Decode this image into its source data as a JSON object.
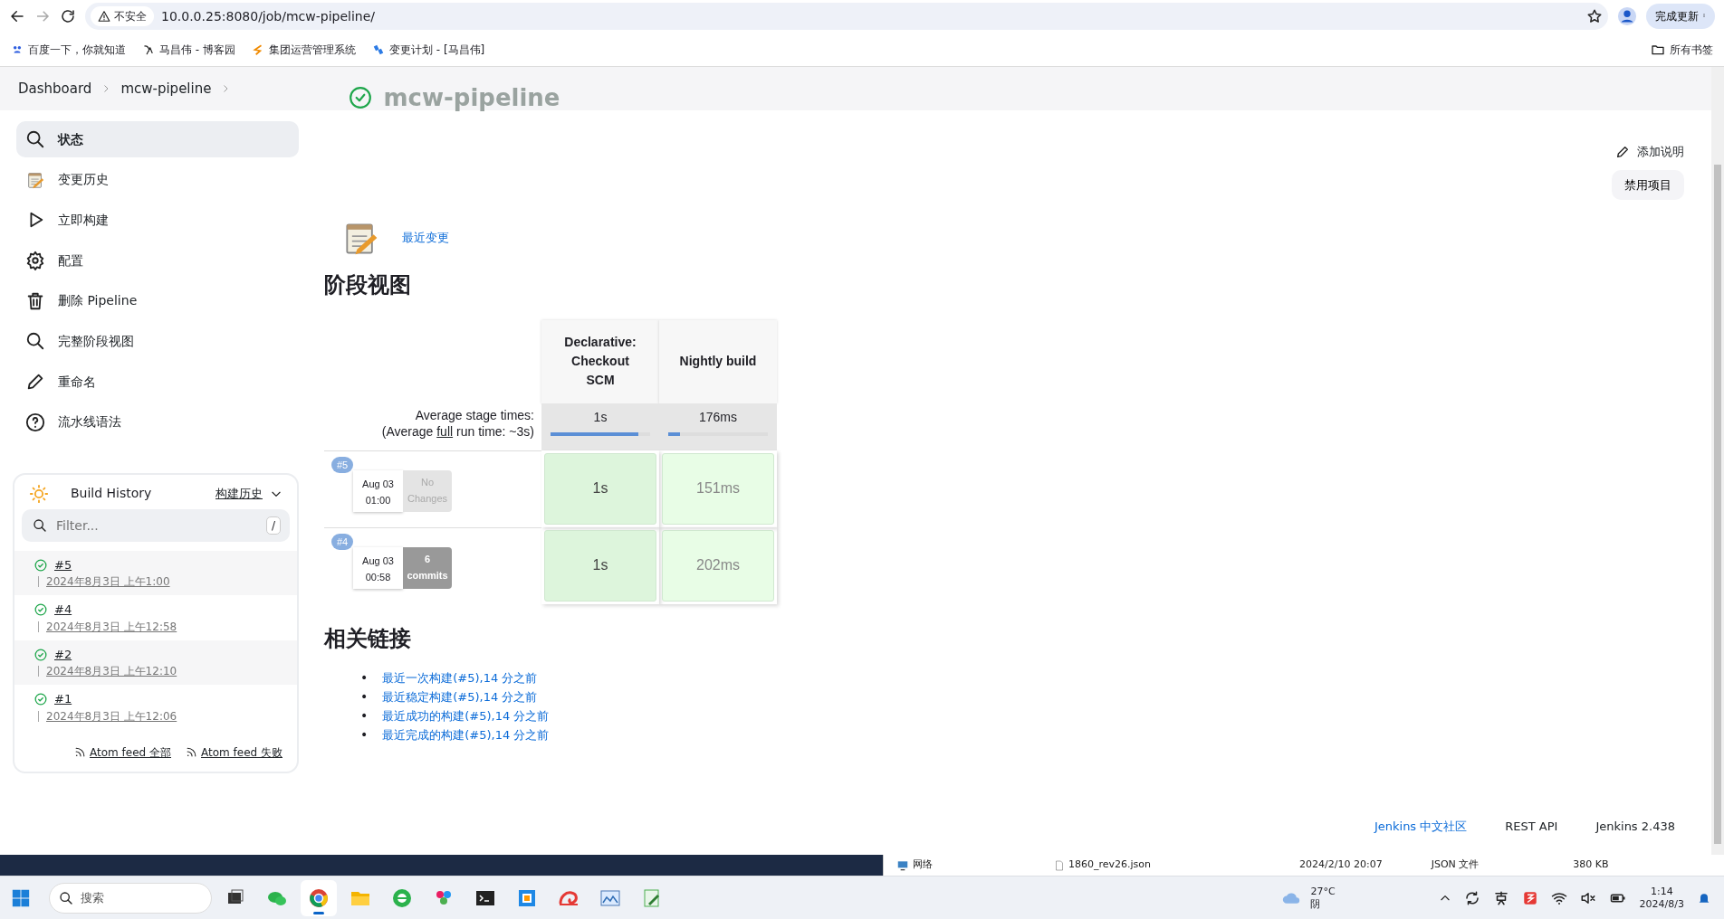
{
  "browser": {
    "security": "不安全",
    "url": "10.0.0.25:8080/job/mcw-pipeline/",
    "update_button": "完成更新",
    "bookmarks": [
      {
        "label": "百度一下，你就知道"
      },
      {
        "label": "马昌伟 - 博客园"
      },
      {
        "label": "集团运营管理系统"
      },
      {
        "label": "变更计划 - [马昌伟]"
      }
    ],
    "all_bookmarks": "所有书签"
  },
  "breadcrumb": [
    {
      "label": "Dashboard"
    },
    {
      "label": "mcw-pipeline"
    }
  ],
  "page_title": "mcw-pipeline",
  "sidebar": {
    "items": [
      {
        "label": "状态",
        "selected": true
      },
      {
        "label": "变更历史",
        "selected": false
      },
      {
        "label": "立即构建",
        "selected": false
      },
      {
        "label": "配置",
        "selected": false
      },
      {
        "label": "删除 Pipeline",
        "selected": false
      },
      {
        "label": "完整阶段视图",
        "selected": false
      },
      {
        "label": "重命名",
        "selected": false
      },
      {
        "label": "流水线语法",
        "selected": false
      }
    ]
  },
  "build_history": {
    "title": "Build History",
    "trend_link": "构建历史",
    "filter_placeholder": "Filter...",
    "filter_shortcut": "/",
    "builds": [
      {
        "number": "#5",
        "time": "2024年8月3日 上午1:00",
        "kind": "success"
      },
      {
        "number": "#4",
        "time": "2024年8月3日 上午12:58",
        "kind": "success"
      },
      {
        "number": "#2",
        "time": "2024年8月3日 上午12:10",
        "kind": "success"
      },
      {
        "number": "#1",
        "time": "2024年8月3日 上午12:06",
        "kind": "success"
      }
    ],
    "feeds": [
      "Atom feed 全部",
      "Atom feed 失败"
    ]
  },
  "actions": {
    "add_description": "添加说明",
    "disable_button": "禁用项目"
  },
  "recent_changes": "最近变更",
  "stage_view": {
    "title": "阶段视图",
    "avg_label": "Average stage times:",
    "avg_run_prefix": "(Average ",
    "avg_run_link": "full",
    "avg_run_suffix": " run time: ~3s)",
    "stages": [
      {
        "name": "Declarative: Checkout SCM",
        "avg": "1s",
        "level": 0.88
      },
      {
        "name": "Nightly build",
        "avg": "176ms",
        "level": 0.12
      }
    ],
    "runs": [
      {
        "badge": "#5",
        "date": "Aug 03",
        "time": "01:00",
        "changes": "No Changes",
        "has_changes": false,
        "cells": [
          "1s",
          "151ms"
        ]
      },
      {
        "badge": "#4",
        "date": "Aug 03",
        "time": "00:58",
        "changes": "6 commits",
        "has_changes": true,
        "cells": [
          "1s",
          "202ms"
        ]
      }
    ]
  },
  "related_links": {
    "title": "相关链接",
    "bullet": "•",
    "links": [
      "最近一次构建(#5),14 分之前",
      "最近稳定构建(#5),14 分之前",
      "最近成功的构建(#5),14 分之前",
      "最近完成的构建(#5),14 分之前"
    ]
  },
  "footer": [
    "Jenkins 中文社区",
    "REST API",
    "Jenkins 2.438"
  ],
  "background_window": {
    "nav_item": "网络",
    "file": "1860_rev26.json",
    "modified": "2024/2/10 20:07",
    "type": "JSON 文件",
    "size": "380 KB"
  },
  "taskbar": {
    "search_placeholder": "搜索",
    "apps": [
      {
        "selected": false
      },
      {
        "selected": false
      },
      {
        "selected": true
      },
      {
        "selected": false
      },
      {
        "selected": false
      },
      {
        "selected": false
      },
      {
        "selected": false
      },
      {
        "selected": false
      },
      {
        "selected": false
      },
      {
        "selected": false
      },
      {
        "selected": false
      }
    ],
    "weather_temp": "27°C",
    "weather_text": "阴",
    "time": "1:14",
    "date": "2024/8/3"
  }
}
